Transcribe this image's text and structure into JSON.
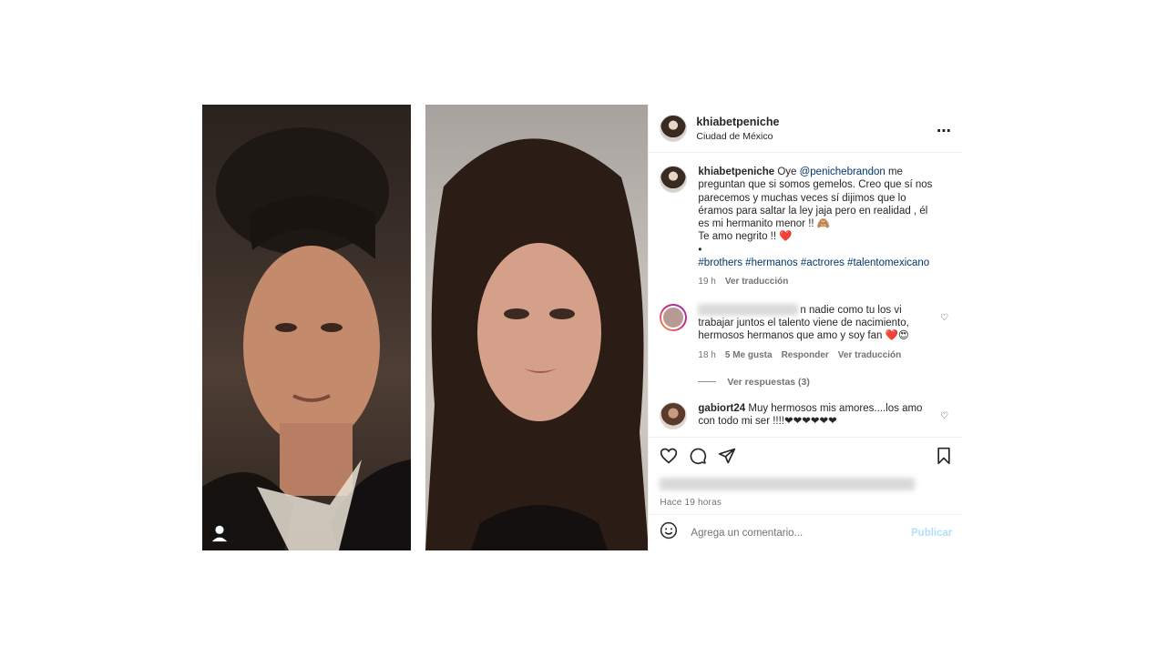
{
  "post": {
    "username": "khiabetpeniche",
    "location": "Ciudad de México",
    "more_icon": "more-horizontal-icon",
    "caption": {
      "username": "khiabetpeniche",
      "text_1": " Oye ",
      "mention": "@penichebrandon",
      "text_2": " me preguntan que si somos gemelos. Creo que sí nos parecemos y muchas veces sí dijimos que lo éramos para saltar la ley jaja pero en realidad , él es mi hermanito menor !! 🙈",
      "line_2": "Te amo negrito !! ❤️",
      "line_3": "•",
      "hashtags": "#brothers #hermanos #actrores #talentomexicano",
      "time": "19 h",
      "translate": "Ver traducción"
    },
    "comments": [
      {
        "text": "n nadie como tu los vi trabajar juntos el talento viene de nacimiento, hermosos hermanos que amo y soy fan ❤️😍",
        "time": "18 h",
        "likes": "5 Me gusta",
        "reply": "Responder",
        "translate": "Ver traducción",
        "view_replies": "Ver respuestas (3)"
      },
      {
        "username": "gabiort24",
        "text": " Muy hermosos mis amores....los amo con todo mi ser !!!!❤❤❤❤❤❤"
      }
    ],
    "time_ago": "Hace 19 horas",
    "add_comment_placeholder": "Agrega un comentario...",
    "publish_label": "Publicar",
    "accent_link": "#00376b",
    "muted": "#737373"
  }
}
